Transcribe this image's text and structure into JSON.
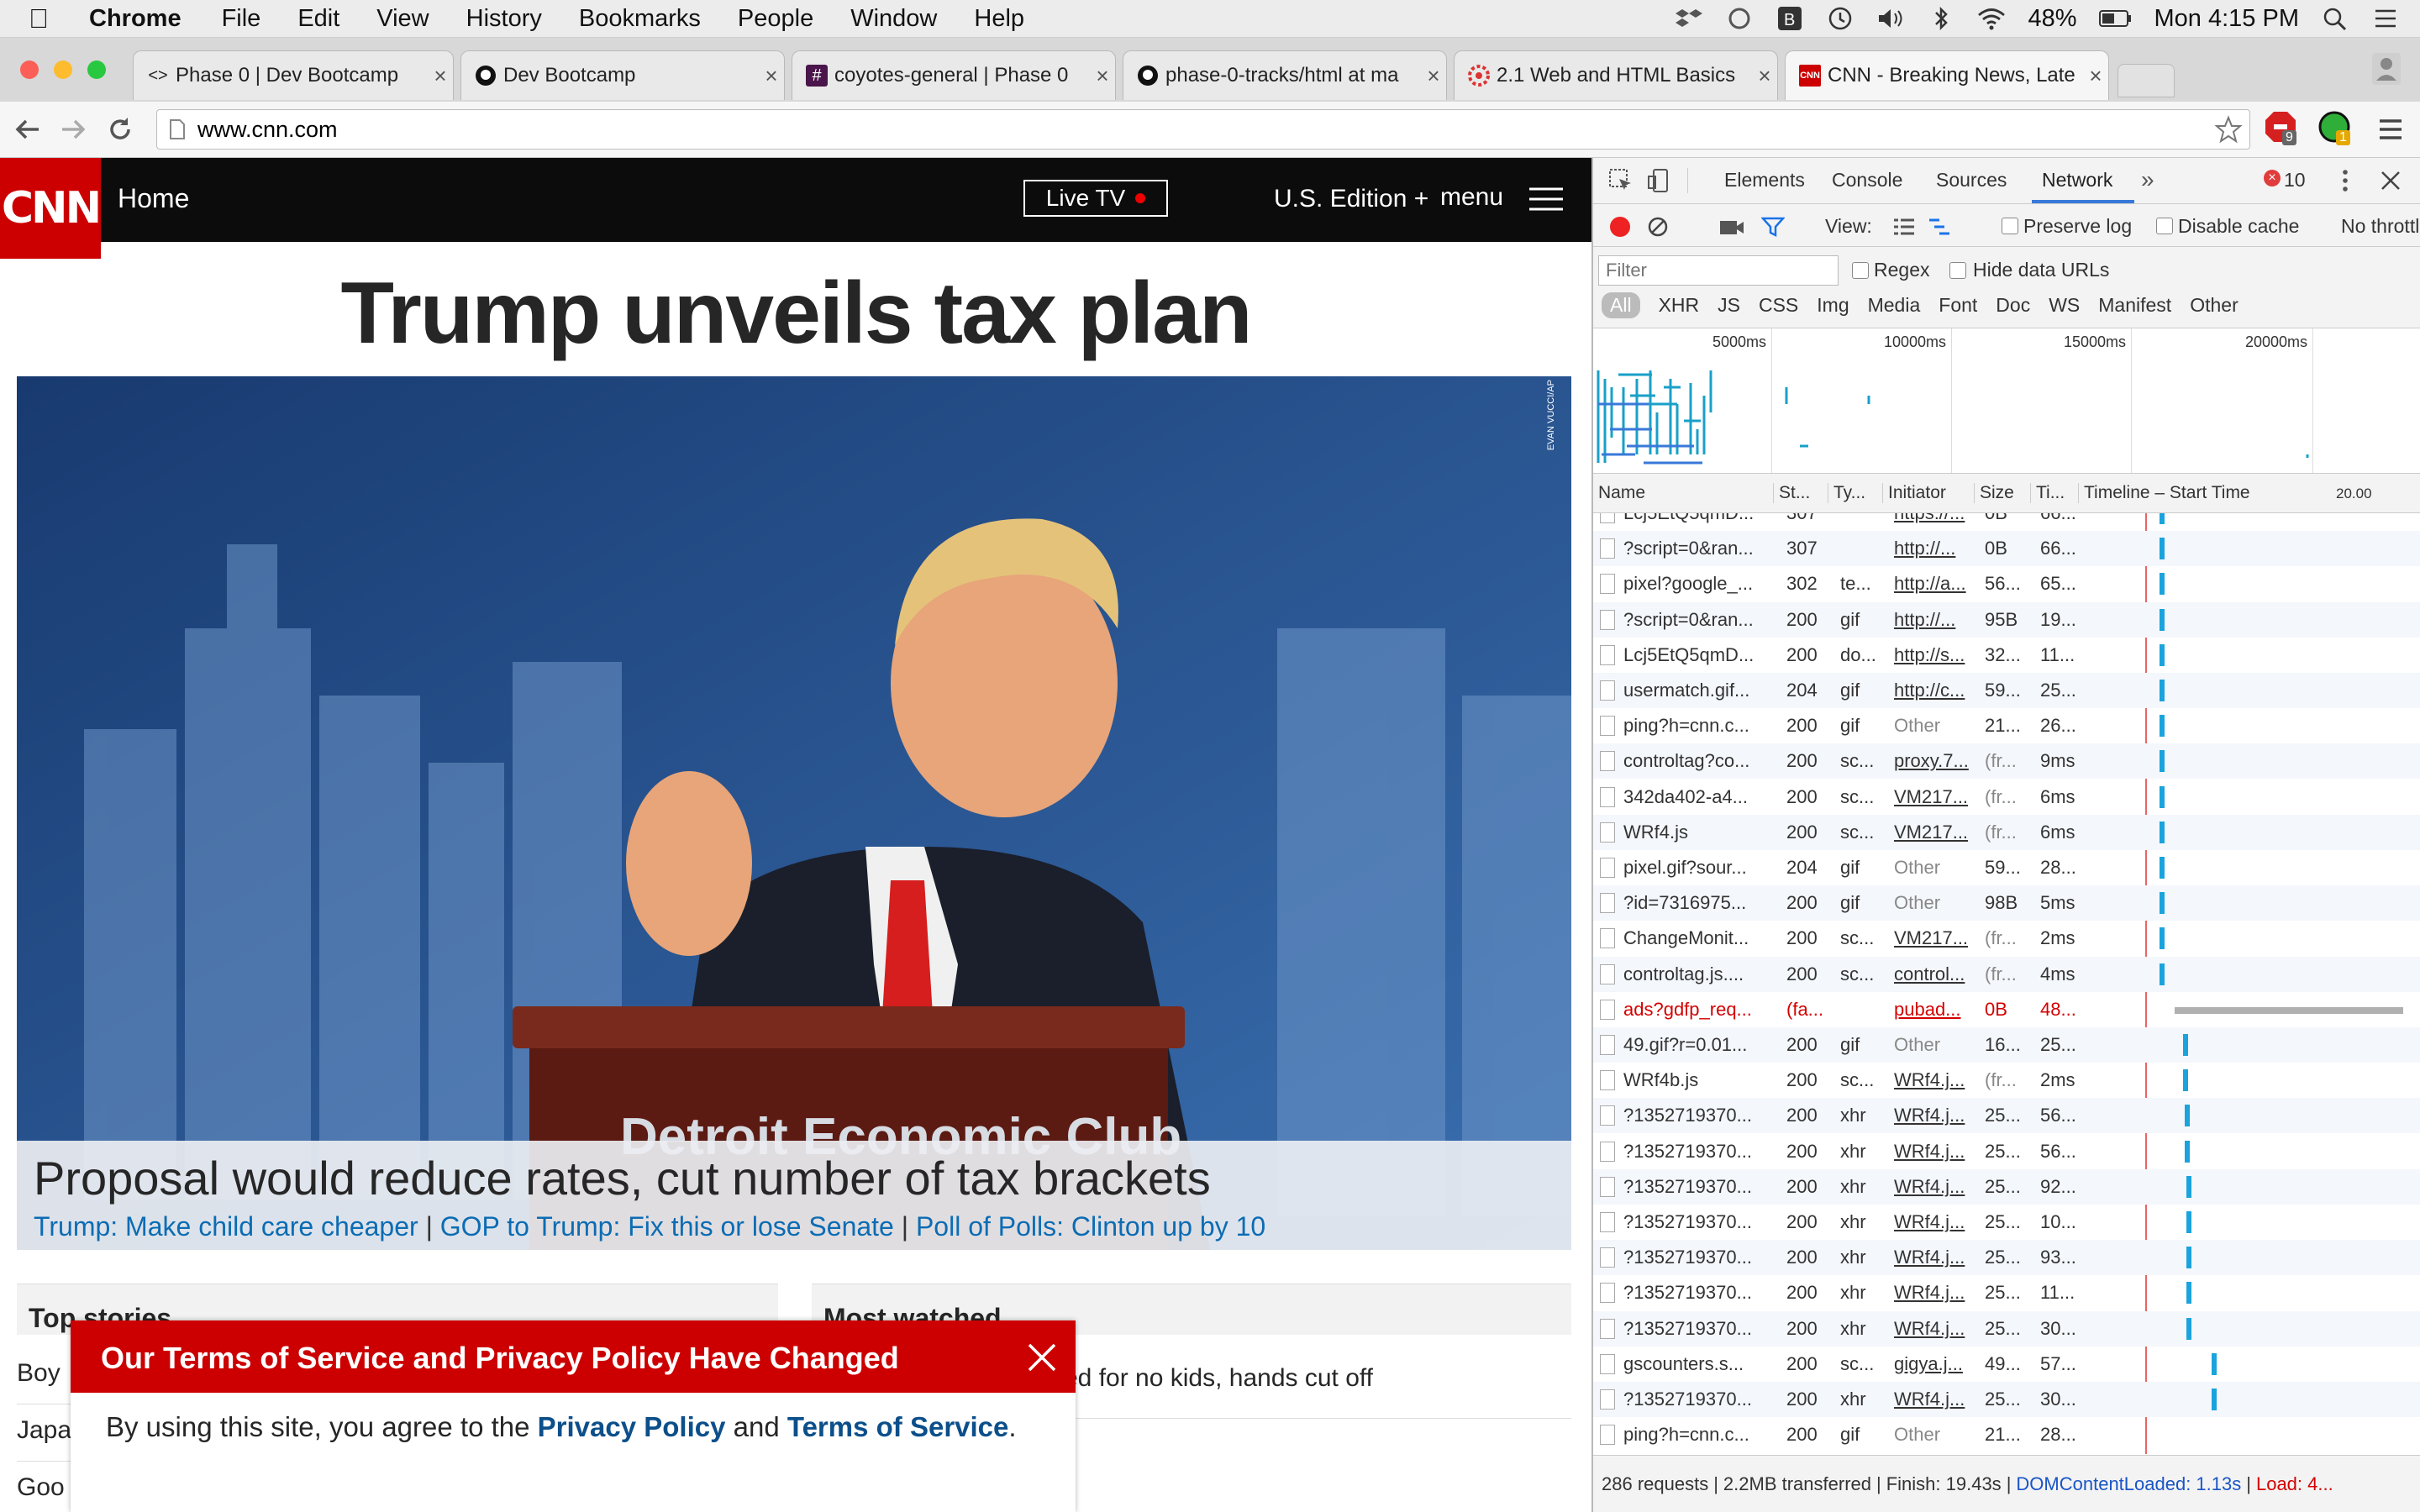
{
  "menubar": {
    "app": "Chrome",
    "items": [
      "File",
      "Edit",
      "View",
      "History",
      "Bookmarks",
      "People",
      "Window",
      "Help"
    ],
    "battery": "48%",
    "clock": "Mon 4:15 PM"
  },
  "tabs": [
    {
      "title": "Phase 0 | Dev Bootcamp",
      "icon": "code-icon"
    },
    {
      "title": "Dev Bootcamp",
      "icon": "github-icon"
    },
    {
      "title": "coyotes-general | Phase 0",
      "icon": "slack-icon"
    },
    {
      "title": "phase-0-tracks/html at ma",
      "icon": "github-icon"
    },
    {
      "title": "2.1 Web and HTML Basics",
      "icon": "gear-icon"
    },
    {
      "title": "CNN - Breaking News, Late",
      "icon": "cnn-icon"
    }
  ],
  "address": {
    "url": "www.cnn.com"
  },
  "extensions": {
    "badge1": "9",
    "badge2": "1"
  },
  "cnn": {
    "logo": "CNN",
    "home": "Home",
    "live_tv": "Live TV",
    "edition": "U.S. Edition +",
    "menu": "menu",
    "headline": "Trump unveils tax plan",
    "photo_credit": "EVAN VUCCI/AP",
    "podium_text": "Detroit Economic Club",
    "caption_title": "Proposal would reduce rates, cut number of tax brackets",
    "related": [
      "Trump: Make child care cheaper",
      "GOP to Trump: Fix this or lose Senate",
      "Poll of Polls: Clinton up by 10"
    ],
    "sep": "|",
    "top_stories": "Top stories",
    "top_items": [
      "Boy",
      "Japa",
      "Goo"
    ],
    "most_watched": "Most watched",
    "mw_item": "ed for no kids, hands cut off",
    "notice": {
      "title": "Our Terms of Service and Privacy Policy Have Changed",
      "body_prefix": "By using this site, you agree to the ",
      "privacy": "Privacy Policy",
      "and": " and ",
      "terms": "Terms of Service",
      "end": "."
    }
  },
  "devtools": {
    "tabs": [
      "Elements",
      "Console",
      "Sources",
      "Network"
    ],
    "active_tab": "Network",
    "error_count": "10",
    "view_label": "View:",
    "preserve_log": "Preserve log",
    "disable_cache": "Disable cache",
    "throttle": "No throttl",
    "filter_placeholder": "Filter",
    "regex": "Regex",
    "hide_data_urls": "Hide data URLs",
    "type_filters": [
      "All",
      "XHR",
      "JS",
      "CSS",
      "Img",
      "Media",
      "Font",
      "Doc",
      "WS",
      "Manifest",
      "Other"
    ],
    "overview_ticks": [
      "5000ms",
      "10000ms",
      "15000ms",
      "20000ms"
    ],
    "columns": [
      "Name",
      "St...",
      "Ty...",
      "Initiator",
      "Size",
      "Ti...",
      "Timeline – Start Time"
    ],
    "timeline_tick": "20.00",
    "rows": [
      {
        "name": "Lcj5EtQ5qmD...",
        "status": "307",
        "type": "",
        "initiator": "https://...",
        "size": "0B",
        "time": "66..."
      },
      {
        "name": "?script=0&ran...",
        "status": "307",
        "type": "",
        "initiator": "http://...",
        "size": "0B",
        "time": "66..."
      },
      {
        "name": "pixel?google_...",
        "status": "302",
        "type": "te...",
        "initiator": "http://a...",
        "size": "56...",
        "time": "65..."
      },
      {
        "name": "?script=0&ran...",
        "status": "200",
        "type": "gif",
        "initiator": "http://...",
        "size": "95B",
        "time": "19..."
      },
      {
        "name": "Lcj5EtQ5qmD...",
        "status": "200",
        "type": "do...",
        "initiator": "http://s...",
        "size": "32...",
        "time": "11..."
      },
      {
        "name": "usermatch.gif...",
        "status": "204",
        "type": "gif",
        "initiator": "http://c...",
        "size": "59...",
        "time": "25..."
      },
      {
        "name": "ping?h=cnn.c...",
        "status": "200",
        "type": "gif",
        "initiator": "Other",
        "size": "21...",
        "time": "26..."
      },
      {
        "name": "controltag?co...",
        "status": "200",
        "type": "sc...",
        "initiator": "proxy.7...",
        "size": "(fr...",
        "time": "9ms"
      },
      {
        "name": "342da402-a4...",
        "status": "200",
        "type": "sc...",
        "initiator": "VM217...",
        "size": "(fr...",
        "time": "6ms"
      },
      {
        "name": "WRf4.js",
        "status": "200",
        "type": "sc...",
        "initiator": "VM217...",
        "size": "(fr...",
        "time": "6ms"
      },
      {
        "name": "pixel.gif?sour...",
        "status": "204",
        "type": "gif",
        "initiator": "Other",
        "size": "59...",
        "time": "28..."
      },
      {
        "name": "?id=7316975...",
        "status": "200",
        "type": "gif",
        "initiator": "Other",
        "size": "98B",
        "time": "5ms"
      },
      {
        "name": "ChangeMonit...",
        "status": "200",
        "type": "sc...",
        "initiator": "VM217...",
        "size": "(fr...",
        "time": "2ms"
      },
      {
        "name": "controltag.js....",
        "status": "200",
        "type": "sc...",
        "initiator": "control...",
        "size": "(fr...",
        "time": "4ms"
      },
      {
        "name": "ads?gdfp_req...",
        "status": "(fa...",
        "type": "",
        "initiator": "pubad...",
        "size": "0B",
        "time": "48...",
        "error": true
      },
      {
        "name": "49.gif?r=0.01...",
        "status": "200",
        "type": "gif",
        "initiator": "Other",
        "size": "16...",
        "time": "25..."
      },
      {
        "name": "WRf4b.js",
        "status": "200",
        "type": "sc...",
        "initiator": "WRf4.j...",
        "size": "(fr...",
        "time": "2ms"
      },
      {
        "name": "?1352719370...",
        "status": "200",
        "type": "xhr",
        "initiator": "WRf4.j...",
        "size": "25...",
        "time": "56..."
      },
      {
        "name": "?1352719370...",
        "status": "200",
        "type": "xhr",
        "initiator": "WRf4.j...",
        "size": "25...",
        "time": "56..."
      },
      {
        "name": "?1352719370...",
        "status": "200",
        "type": "xhr",
        "initiator": "WRf4.j...",
        "size": "25...",
        "time": "92..."
      },
      {
        "name": "?1352719370...",
        "status": "200",
        "type": "xhr",
        "initiator": "WRf4.j...",
        "size": "25...",
        "time": "10..."
      },
      {
        "name": "?1352719370...",
        "status": "200",
        "type": "xhr",
        "initiator": "WRf4.j...",
        "size": "25...",
        "time": "93..."
      },
      {
        "name": "?1352719370...",
        "status": "200",
        "type": "xhr",
        "initiator": "WRf4.j...",
        "size": "25...",
        "time": "11..."
      },
      {
        "name": "?1352719370...",
        "status": "200",
        "type": "xhr",
        "initiator": "WRf4.j...",
        "size": "25...",
        "time": "30..."
      },
      {
        "name": "gscounters.s...",
        "status": "200",
        "type": "sc...",
        "initiator": "gigya.j...",
        "size": "49...",
        "time": "57..."
      },
      {
        "name": "?1352719370...",
        "status": "200",
        "type": "xhr",
        "initiator": "WRf4.j...",
        "size": "25...",
        "time": "30..."
      },
      {
        "name": "ping?h=cnn.c...",
        "status": "200",
        "type": "gif",
        "initiator": "Other",
        "size": "21...",
        "time": "28..."
      }
    ],
    "summary": {
      "requests": "286 requests",
      "transferred": "2.2MB transferred",
      "finish": "Finish: 19.43s",
      "dcl": "DOMContentLoaded: 1.13s",
      "load": "Load: 4..."
    }
  },
  "colors": {
    "cnn_red": "#cc0000",
    "link": "#0c6cb3",
    "devtools_blue": "#1a73e8",
    "error": "#d40000"
  }
}
